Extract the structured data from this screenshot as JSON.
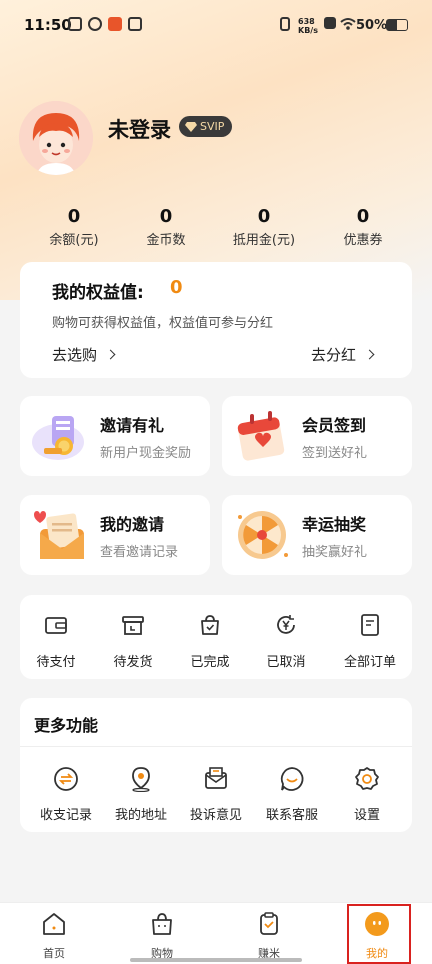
{
  "status_bar": {
    "time": "11:50",
    "speed": "638 KB/s",
    "battery": "50%"
  },
  "profile": {
    "username": "未登录",
    "badge": "SVIP"
  },
  "stats": [
    {
      "value": "0",
      "label": "余额(元)"
    },
    {
      "value": "0",
      "label": "金币数"
    },
    {
      "value": "0",
      "label": "抵用金(元)"
    },
    {
      "value": "0",
      "label": "优惠券"
    }
  ],
  "equity": {
    "title": "我的权益值:",
    "value": "0",
    "description": "购物可获得权益值，权益值可参与分红",
    "link_shop": "去选购",
    "link_dividend": "去分红"
  },
  "promos": [
    {
      "title": "邀请有礼",
      "subtitle": "新用户现金奖励",
      "icon": "invite-gift-icon"
    },
    {
      "title": "会员签到",
      "subtitle": "签到送好礼",
      "icon": "calendar-checkin-icon"
    },
    {
      "title": "我的邀请",
      "subtitle": "查看邀请记录",
      "icon": "envelope-icon"
    },
    {
      "title": "幸运抽奖",
      "subtitle": "抽奖赢好礼",
      "icon": "prize-wheel-icon"
    }
  ],
  "orders": [
    {
      "label": "待支付",
      "icon": "wallet-icon"
    },
    {
      "label": "待发货",
      "icon": "box-icon"
    },
    {
      "label": "已完成",
      "icon": "bag-check-icon"
    },
    {
      "label": "已取消",
      "icon": "yen-refresh-icon"
    },
    {
      "label": "全部订单",
      "icon": "document-icon"
    }
  ],
  "more": {
    "title": "更多功能",
    "items": [
      {
        "label": "收支记录",
        "icon": "exchange-icon"
      },
      {
        "label": "我的地址",
        "icon": "location-icon"
      },
      {
        "label": "投诉意见",
        "icon": "mail-icon"
      },
      {
        "label": "联系客服",
        "icon": "chat-smile-icon"
      },
      {
        "label": "设置",
        "icon": "gear-icon"
      }
    ]
  },
  "nav": [
    {
      "label": "首页",
      "icon": "home-icon"
    },
    {
      "label": "购物",
      "icon": "shopping-bag-icon"
    },
    {
      "label": "赚米",
      "icon": "earn-icon"
    },
    {
      "label": "我的",
      "icon": "profile-face-icon",
      "active": true
    }
  ],
  "colors": {
    "accent": "#f08a12",
    "highlight": "#d9221f"
  }
}
